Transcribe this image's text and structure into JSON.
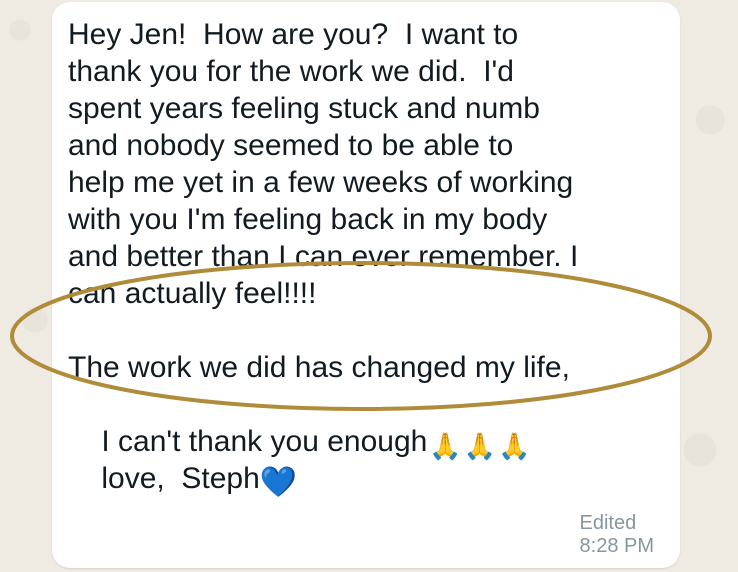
{
  "message": {
    "lines": [
      "Hey Jen!  How are you?  I want to",
      "thank you for the work we did.  I'd",
      "spent years feeling stuck and numb",
      "and nobody seemed to be able to",
      "help me yet in a few weeks of working",
      "with you I'm feeling back in my body",
      "and better than I can ever remember. I",
      "can actually feel!!!!"
    ],
    "line2": [
      "The work we did has changed my life,",
      "I can't thank you enough",
      "love,  Steph"
    ]
  },
  "icons": {
    "pray": "folded-hands-icon",
    "heart": "blue-heart-icon"
  },
  "meta": {
    "edited_label": "Edited",
    "time": "8:28 PM"
  },
  "colors": {
    "bubble": "#ffffff",
    "background": "#efeae2",
    "text": "#111b21",
    "meta": "#8696a0",
    "ellipse": "#b08b3a",
    "heart": "#1d8cf0"
  }
}
